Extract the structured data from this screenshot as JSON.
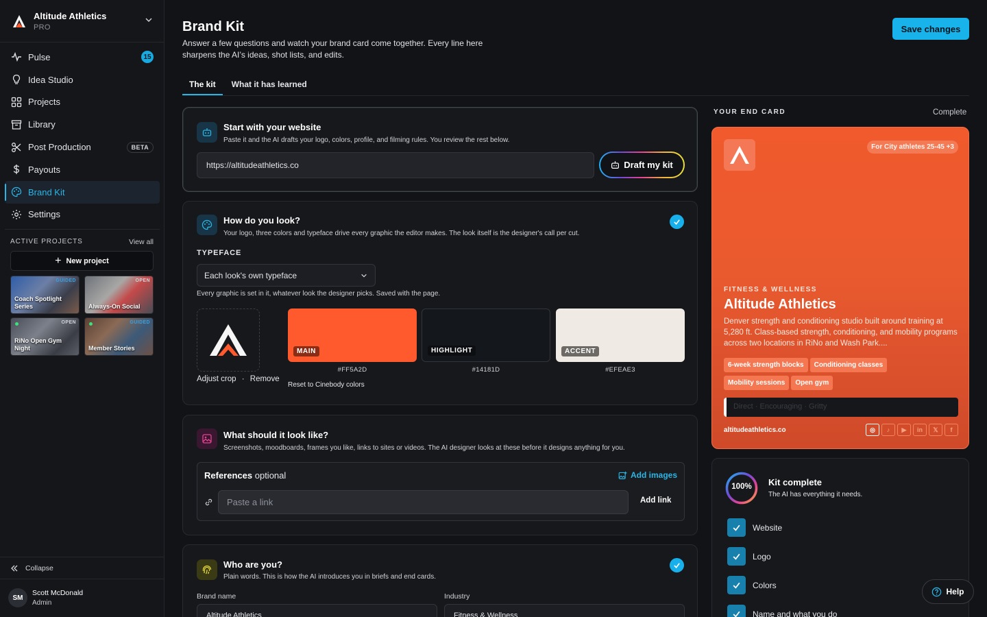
{
  "workspace": {
    "name": "Altitude Athletics",
    "plan": "PRO"
  },
  "nav": {
    "items": [
      {
        "label": "Pulse",
        "icon": "pulse-icon",
        "badge": "15"
      },
      {
        "label": "Idea Studio",
        "icon": "lightbulb-icon"
      },
      {
        "label": "Projects",
        "icon": "grid-icon"
      },
      {
        "label": "Library",
        "icon": "archive-icon"
      },
      {
        "label": "Post Production",
        "icon": "scissors-icon",
        "badge": "BETA"
      },
      {
        "label": "Payouts",
        "icon": "dollar-icon"
      },
      {
        "label": "Brand Kit",
        "icon": "palette-icon",
        "active": true
      },
      {
        "label": "Settings",
        "icon": "gear-icon"
      }
    ]
  },
  "active_projects": {
    "heading": "ACTIVE PROJECTS",
    "view_all": "View all",
    "new_project": "New project",
    "projects": [
      {
        "name": "Coach Spotlight Series",
        "status": "GUIDED"
      },
      {
        "name": "Always-On Social",
        "status": "OPEN"
      },
      {
        "name": "RiNo Open Gym Night",
        "status": "OPEN"
      },
      {
        "name": "Member Stories",
        "status": "GUIDED"
      }
    ]
  },
  "sidebar_footer": {
    "collapse": "Collapse",
    "user_initials": "SM",
    "user_name": "Scott McDonald",
    "user_role": "Admin"
  },
  "page": {
    "title": "Brand Kit",
    "subtitle": "Answer a few questions and watch your brand card come together. Every line here sharpens the AI’s ideas, shot lists, and edits.",
    "save": "Save changes",
    "tabs": [
      "The kit",
      "What it has learned"
    ]
  },
  "website": {
    "title": "Start with your website",
    "desc": "Paste it and the AI drafts your logo, colors, profile, and filming rules. You review the rest below.",
    "url": "https://altitudeathletics.co",
    "draft": "Draft my kit"
  },
  "look": {
    "title": "How do you look?",
    "desc": "Your logo, three colors and typeface drive every graphic the editor makes. The look itself is the designer's call per cut.",
    "typeface_label": "TYPEFACE",
    "typeface_value": "Each look's own typeface",
    "typeface_hint": "Every graphic is set in it, whatever look the designer picks. Saved with the page.",
    "adjust_crop": "Adjust crop",
    "sep": "·",
    "remove": "Remove",
    "swatches": [
      {
        "label": "MAIN",
        "hex": "#FF5A2D",
        "color": "#FF5A2D"
      },
      {
        "label": "HIGHLIGHT",
        "hex": "#14181D",
        "color": "#14181D"
      },
      {
        "label": "ACCENT",
        "hex": "#EFEAE3",
        "color": "#EFEAE3"
      }
    ],
    "reset": "Reset to Cinebody colors"
  },
  "references": {
    "title": "What should it look like?",
    "desc": "Screenshots, moodboards, frames you like, links to sites or videos. The AI designer looks at these before it designs anything for you.",
    "box_title": "References",
    "box_optional": "optional",
    "add_images": "Add images",
    "link_placeholder": "Paste a link",
    "add_link": "Add link"
  },
  "identity": {
    "title": "Who are you?",
    "desc": "Plain words. This is how the AI introduces you in briefs and end cards.",
    "brand_label": "Brand name",
    "brand_value": "Altitude Athletics",
    "industry_label": "Industry",
    "industry_value": "Fitness & Wellness"
  },
  "end_card": {
    "heading": "YOUR END CARD",
    "status": "Complete",
    "audience": "For City athletes 25-45 +3",
    "industry": "FITNESS & WELLNESS",
    "name": "Altitude Athletics",
    "description": "Denver strength and conditioning studio built around training at 5,280 ft. Class-based strength, conditioning, and mobility programs across two locations in RiNo and Wash Park....",
    "chips": [
      "6-week strength blocks",
      "Conditioning classes",
      "Mobility sessions",
      "Open gym"
    ],
    "tone": "Direct · Encouraging · Gritty",
    "website": "altitudeathletics.co",
    "socials": [
      "instagram-icon",
      "tiktok-icon",
      "youtube-icon",
      "linkedin-icon",
      "x-icon",
      "facebook-icon"
    ],
    "social_glyphs": [
      "◎",
      "♪",
      "▶",
      "in",
      "𝕏",
      "f"
    ]
  },
  "kit_status": {
    "percent": "100%",
    "title": "Kit complete",
    "subtitle": "The AI has everything it needs.",
    "items": [
      "Website",
      "Logo",
      "Colors",
      "Name and what you do"
    ]
  },
  "help": "Help"
}
